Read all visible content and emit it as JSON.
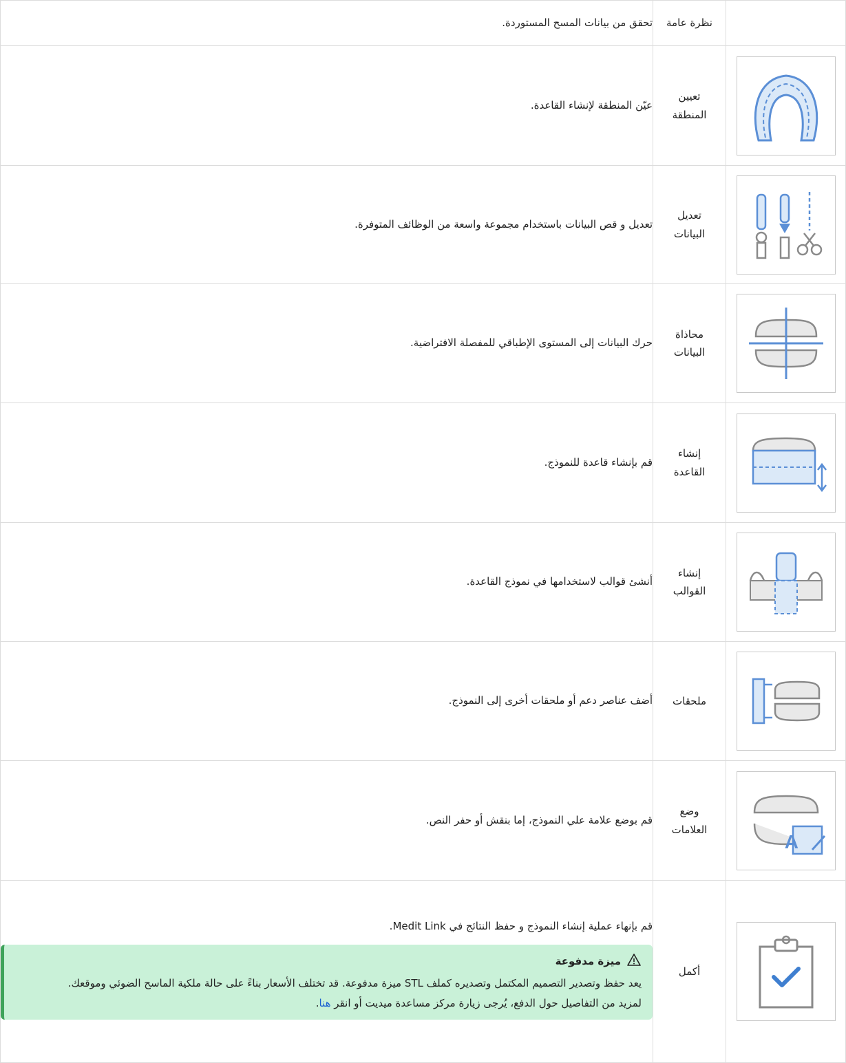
{
  "header": {
    "name": "نظرة عامة",
    "description": "تحقق من بيانات المسح المستوردة."
  },
  "steps": [
    {
      "name": "تعيين\nالمنطقة",
      "description": "عيّن المنطقة لإنشاء القاعدة.",
      "icon": "dental-arch-icon"
    },
    {
      "name": "تعديل\nالبيانات",
      "description": "تعديل و قص البيانات باستخدام مجموعة واسعة من الوظائف المتوفرة.",
      "icon": "edit-trim-tools-icon"
    },
    {
      "name": "محاذاة\nالبيانات",
      "description": "حرك البيانات إلى المستوى الإطباقي للمفصلة الافتراضية.",
      "icon": "align-occlusal-plane-icon"
    },
    {
      "name": "إنشاء\nالقاعدة",
      "description": "قم بإنشاء قاعدة للنموذج.",
      "icon": "create-base-icon"
    },
    {
      "name": "إنشاء\nالقوالب",
      "description": "أنشئ قوالب لاستخدامها في نموذج القاعدة.",
      "icon": "create-die-icon"
    },
    {
      "name": "ملحقات",
      "description": "أضف عناصر دعم أو ملحقات أخرى إلى النموذج.",
      "icon": "attachments-icon"
    },
    {
      "name": "وضع\nالعلامات",
      "description": "قم بوضع علامة علي النموذج، إما بنقش أو حفر النص.",
      "icon": "labeling-icon"
    }
  ],
  "complete": {
    "name": "أكمل",
    "description": "قم بإنهاء عملية إنشاء النموذج و حفظ النتائج في Medit Link.",
    "icon": "clipboard-check-icon",
    "callout": {
      "title": "ميزة مدفوعة",
      "icon": "warning-icon",
      "body": "يعد حفظ وتصدير التصميم المكتمل وتصديره كملف STL ميزة مدفوعة. قد تختلف الأسعار بناءً على حالة ملكية الماسح الضوئي وموقعك.",
      "more_prefix": "لمزيد من التفاصيل حول الدفع، يُرجى زيارة مركز مساعدة ميديت أو انقر ",
      "link_text": "هنا",
      "more_suffix": "."
    }
  },
  "colors": {
    "icon_blue": "#5b8fd6",
    "icon_light": "#dbe9f8",
    "icon_gray": "#8a8a8a",
    "callout_bg": "#c9f1d8",
    "callout_border": "#3fa35b",
    "link": "#1a5fd1"
  }
}
